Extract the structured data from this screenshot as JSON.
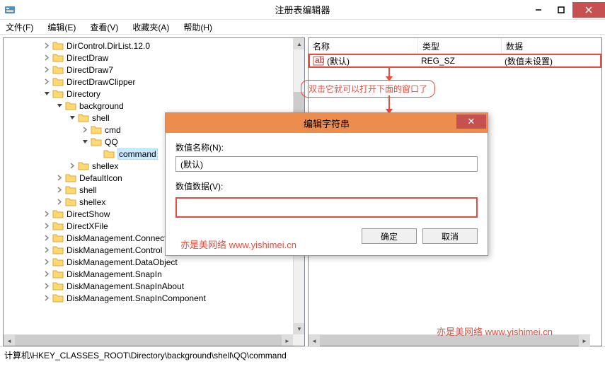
{
  "window": {
    "title": "注册表编辑器"
  },
  "menu": {
    "file": "文件(F)",
    "edit": "编辑(E)",
    "view": "查看(V)",
    "favorites": "收藏夹(A)",
    "help": "帮助(H)"
  },
  "tree": {
    "items": [
      {
        "indent": 56,
        "exp": "r",
        "label": "DirControl.DirList.12.0"
      },
      {
        "indent": 56,
        "exp": "r",
        "label": "DirectDraw"
      },
      {
        "indent": 56,
        "exp": "r",
        "label": "DirectDraw7"
      },
      {
        "indent": 56,
        "exp": "r",
        "label": "DirectDrawClipper"
      },
      {
        "indent": 56,
        "exp": "d",
        "label": "Directory"
      },
      {
        "indent": 74,
        "exp": "d",
        "label": "background"
      },
      {
        "indent": 92,
        "exp": "d",
        "label": "shell"
      },
      {
        "indent": 110,
        "exp": "r",
        "label": "cmd"
      },
      {
        "indent": 110,
        "exp": "d",
        "label": "QQ"
      },
      {
        "indent": 128,
        "exp": "n",
        "label": "command",
        "selected": true
      },
      {
        "indent": 92,
        "exp": "r",
        "label": "shellex"
      },
      {
        "indent": 74,
        "exp": "r",
        "label": "DefaultIcon"
      },
      {
        "indent": 74,
        "exp": "r",
        "label": "shell"
      },
      {
        "indent": 74,
        "exp": "r",
        "label": "shellex"
      },
      {
        "indent": 56,
        "exp": "r",
        "label": "DirectShow"
      },
      {
        "indent": 56,
        "exp": "r",
        "label": "DirectXFile"
      },
      {
        "indent": 56,
        "exp": "r",
        "label": "DiskManagement.Connection"
      },
      {
        "indent": 56,
        "exp": "r",
        "label": "DiskManagement.Control"
      },
      {
        "indent": 56,
        "exp": "r",
        "label": "DiskManagement.DataObject"
      },
      {
        "indent": 56,
        "exp": "r",
        "label": "DiskManagement.SnapIn"
      },
      {
        "indent": 56,
        "exp": "r",
        "label": "DiskManagement.SnapInAbout"
      },
      {
        "indent": 56,
        "exp": "r",
        "label": "DiskManagement.SnapInComponent"
      }
    ]
  },
  "list": {
    "cols": {
      "name": "名称",
      "type": "类型",
      "data": "数据"
    },
    "row": {
      "name": "(默认)",
      "type": "REG_SZ",
      "data": "(数值未设置)"
    }
  },
  "annotation": {
    "text": "双击它就可以打开下面的窗口了"
  },
  "dialog": {
    "title": "编辑字符串",
    "name_label": "数值名称(N):",
    "name_value": "(默认)",
    "data_label": "数值数据(V):",
    "data_value": "",
    "ok": "确定",
    "cancel": "取消"
  },
  "watermark": "亦是美网络  www.yishimei.cn",
  "statusbar": {
    "path": "计算机\\HKEY_CLASSES_ROOT\\Directory\\background\\shell\\QQ\\command"
  }
}
